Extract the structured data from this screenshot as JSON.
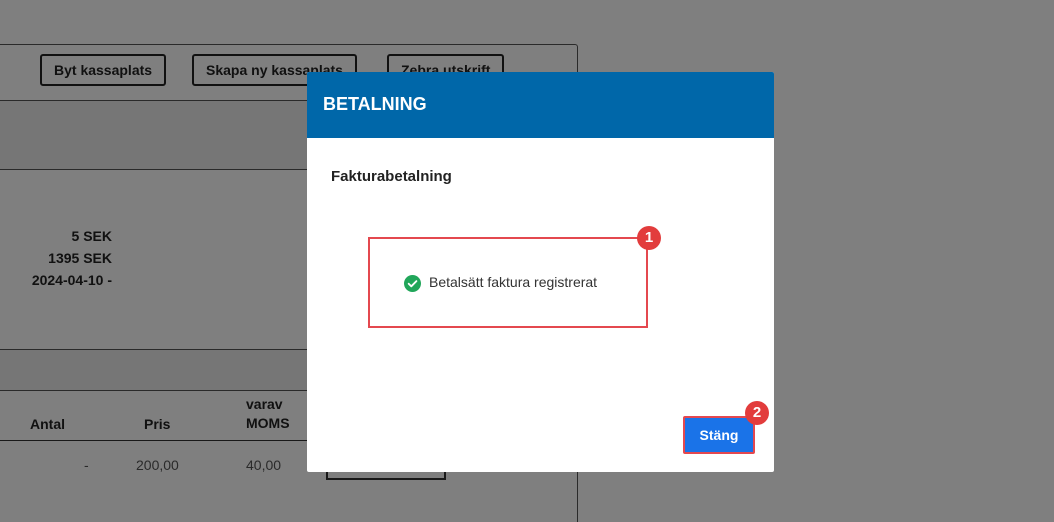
{
  "background": {
    "buttons": [
      "Byt kassaplats",
      "Skapa ny kassaplats",
      "Zebra utskrift"
    ],
    "amounts": [
      "5 SEK",
      "1395 SEK",
      "2024-04-10 -"
    ],
    "table": {
      "headers": {
        "antal": "Antal",
        "pris": "Pris",
        "moms_line1": "varav",
        "moms_line2": "MOMS"
      },
      "row": {
        "antal": "-",
        "pris": "200,00",
        "moms": "40,00"
      }
    }
  },
  "modal": {
    "title": "BETALNING",
    "subtitle": "Fakturabetalning",
    "message": "Betalsätt faktura registrerat",
    "close_label": "Stäng",
    "header_color": "#0067a9",
    "success_icon": "check-circle-icon"
  },
  "annotations": {
    "badge1": "1",
    "badge2": "2"
  }
}
